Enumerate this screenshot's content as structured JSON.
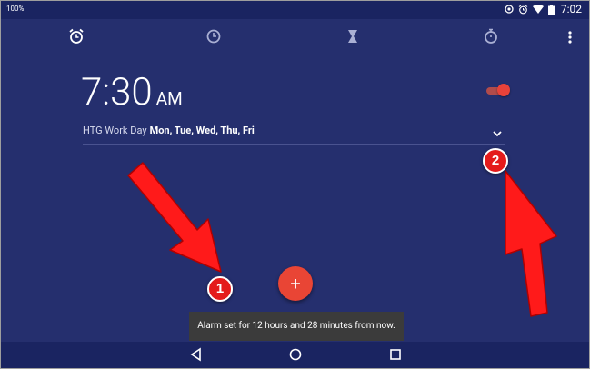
{
  "statusbar": {
    "left_text": "100%",
    "time": "7:02",
    "icons": [
      "sync-icon",
      "alarm-icon",
      "wifi-icon",
      "battery-icon"
    ]
  },
  "tabs": [
    {
      "name": "alarm",
      "icon": "alarm-clock-icon",
      "active": true
    },
    {
      "name": "clock",
      "icon": "clock-icon",
      "active": false
    },
    {
      "name": "timer",
      "icon": "hourglass-icon",
      "active": false
    },
    {
      "name": "stopwatch",
      "icon": "stopwatch-icon",
      "active": false
    }
  ],
  "alarm": {
    "time": "7:30",
    "ampm": "AM",
    "enabled": true,
    "label": "HTG Work Day",
    "days": "Mon, Tue, Wed, Thu, Fri"
  },
  "fab": {
    "label": "+"
  },
  "toast": {
    "text": "Alarm set for 12 hours and 28 minutes from now."
  },
  "annotations": {
    "badge1": "1",
    "badge2": "2"
  },
  "colors": {
    "background": "#252f6e",
    "statusbar": "#1a2461",
    "accent": "#e94535",
    "annotation_red": "#e41b1b"
  }
}
